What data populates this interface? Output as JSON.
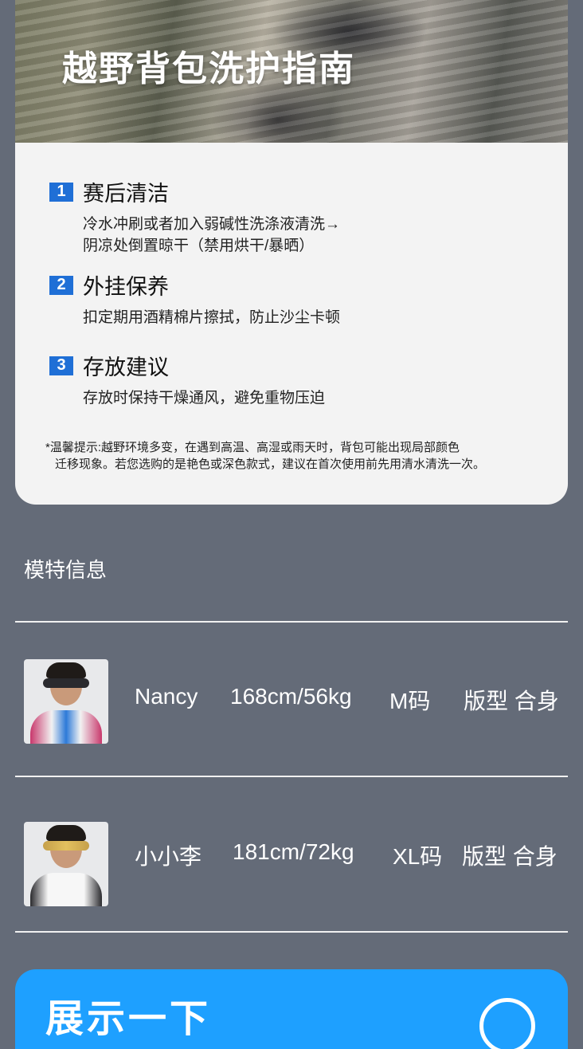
{
  "hero": {
    "title": "越野背包洗护指南"
  },
  "care_steps": [
    {
      "number": "1",
      "title": "赛后清洁",
      "desc_lines": [
        "冷水冲刷或者加入弱碱性洗涤液清洗→",
        "阴凉处倒置晾干（禁用烘干/暴晒）"
      ]
    },
    {
      "number": "2",
      "title": "外挂保养",
      "desc_lines": [
        "扣定期用酒精棉片擦拭，防止沙尘卡顿"
      ]
    },
    {
      "number": "3",
      "title": "存放建议",
      "desc_lines": [
        "存放时保持干燥通风，避免重物压迫"
      ]
    }
  ],
  "note": {
    "line1": "*温馨提示:越野环境多变，在遇到高温、高湿或雨天时，背包可能出现局部颜色",
    "line2": "迁移现象。若您选购的是艳色或深色款式，建议在首次使用前先用清水清洗一次。"
  },
  "models": {
    "section_title": "模特信息",
    "items": [
      {
        "name": "Nancy",
        "measurements": "168cm/56kg",
        "size": "M码",
        "fit": "版型 合身"
      },
      {
        "name": "小小李",
        "measurements": "181cm/72kg",
        "size": "XL码",
        "fit": "版型 合身"
      }
    ]
  },
  "bottom": {
    "title": "展示一下"
  },
  "colors": {
    "background": "#646b78",
    "accent_blue": "#1ea0ff",
    "step_badge": "#1f6fd6",
    "card": "#f3f3f3"
  }
}
